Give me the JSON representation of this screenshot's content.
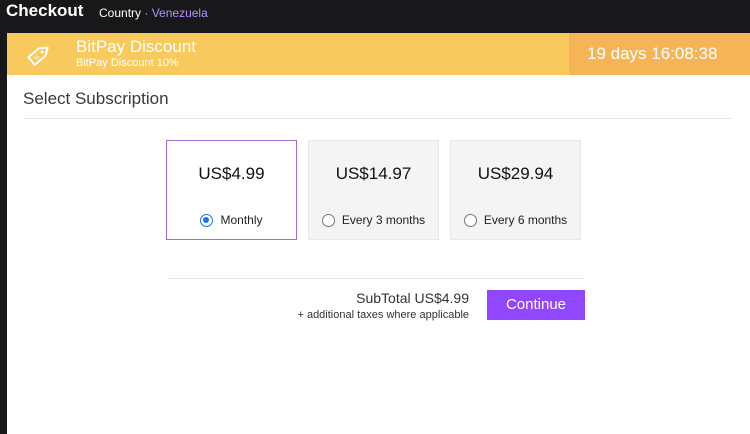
{
  "header": {
    "title": "Checkout",
    "country_label": "Country",
    "separator": "·",
    "country_value": "Venezuela"
  },
  "banner": {
    "icon": "discount-tag-icon",
    "title": "BitPay Discount",
    "subtitle": "BitPay Discount 10%",
    "timer": "19 days 16:08:38"
  },
  "section": {
    "title": "Select Subscription"
  },
  "plans": [
    {
      "price": "US$4.99",
      "label": "Monthly",
      "selected": true
    },
    {
      "price": "US$14.97",
      "label": "Every 3 months",
      "selected": false
    },
    {
      "price": "US$29.94",
      "label": "Every 6 months",
      "selected": false
    }
  ],
  "summary": {
    "subtotal": "SubTotal US$4.99",
    "taxes_note": "+ additional taxes where applicable",
    "continue_label": "Continue"
  },
  "colors": {
    "banner": "#f8c95c",
    "timer_bg": "#f5b556",
    "accent": "#9147ff",
    "selected_border": "#9b6dd6",
    "radio": "#1a73e8"
  }
}
